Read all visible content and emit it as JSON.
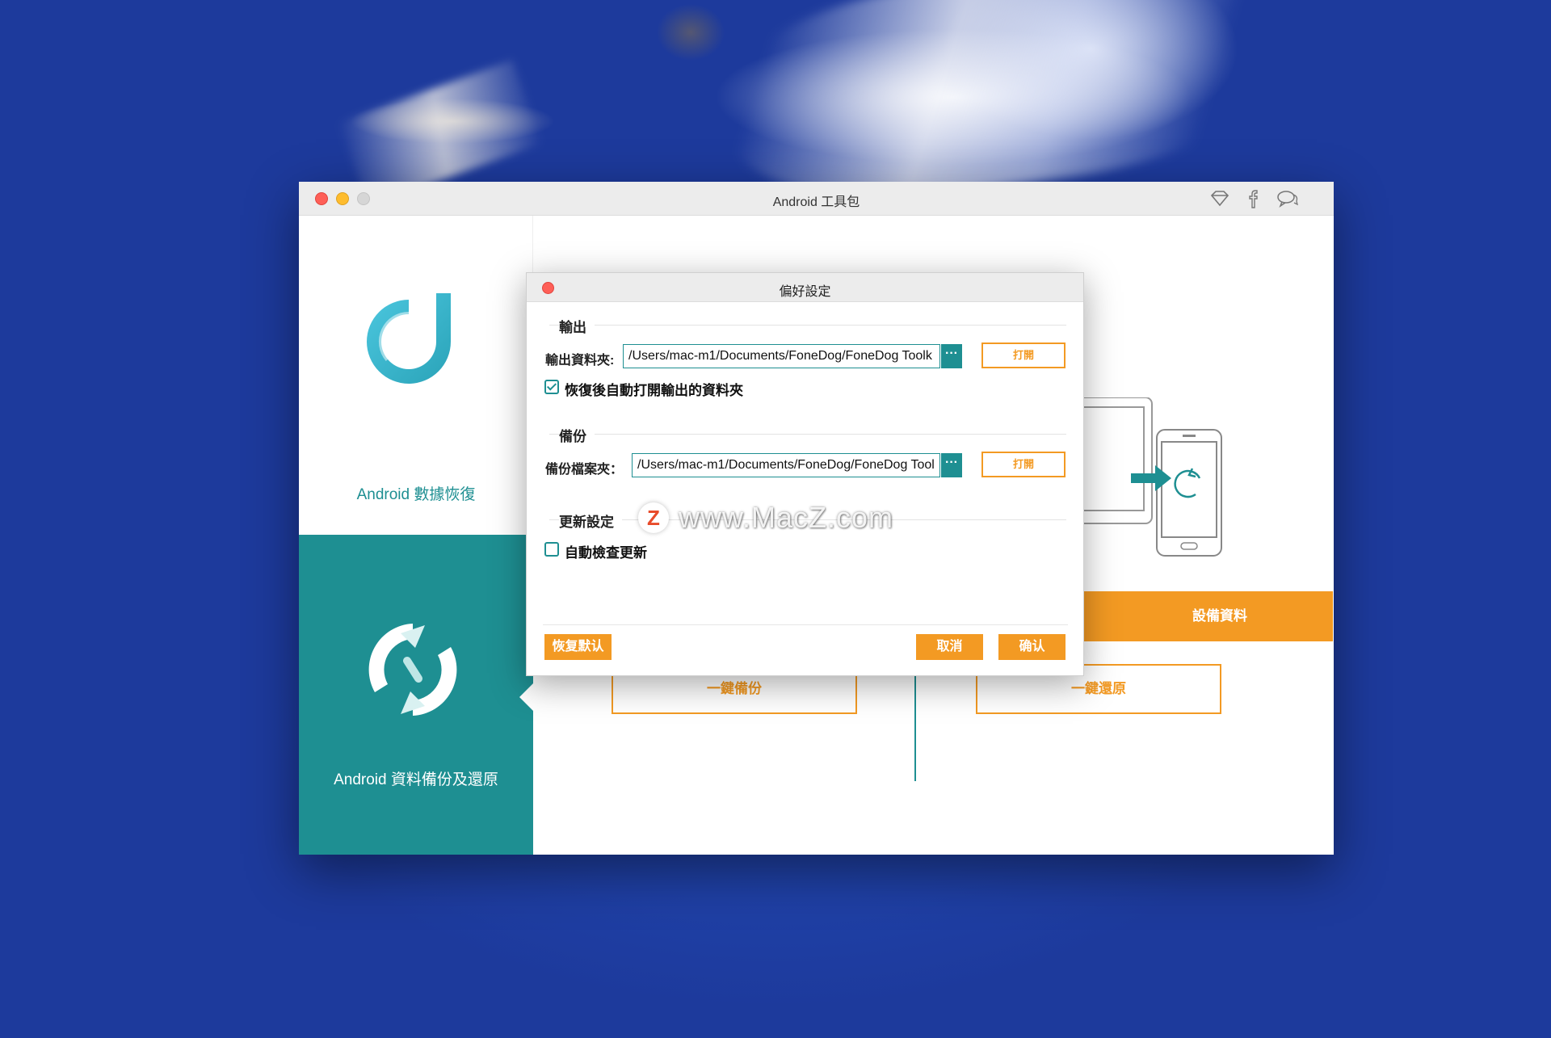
{
  "window": {
    "title": "Android 工具包",
    "toolbar_icons": [
      "diamond-icon",
      "facebook-icon",
      "chat-icon"
    ]
  },
  "sidebar": {
    "items": [
      {
        "label": "Android 數據恢復",
        "icon": "data-recovery-logo"
      },
      {
        "label": "Android 資料備份及還原",
        "icon": "sync-logo",
        "active": true
      }
    ]
  },
  "main": {
    "restore_device_button": "設備資料",
    "one_click_backup_button": "一鍵備份",
    "one_click_restore_button": "一鍵還原"
  },
  "dialog": {
    "title": "偏好設定",
    "output_section": "輸出",
    "output_folder_label": "輸出資料夾:",
    "output_folder_value": "/Users/mac-m1/Documents/FoneDog/FoneDog Toolk",
    "output_open_button": "打開",
    "auto_open_checkbox_label": "恢復後自動打開輸出的資料夾",
    "auto_open_checked": true,
    "backup_section": "備份",
    "backup_folder_label": "備份檔案夾：",
    "backup_folder_value": "/Users/mac-m1/Documents/FoneDog/FoneDog Tool",
    "backup_open_button": "打開",
    "update_section": "更新設定",
    "auto_update_checkbox_label": "自動檢查更新",
    "auto_update_checked": false,
    "browse_button": "···",
    "reset_button": "恢复默认",
    "cancel_button": "取消",
    "confirm_button": "确认"
  },
  "watermark": {
    "logo": "Z",
    "text": "www.MacZ.com"
  },
  "colors": {
    "teal": "#1e8f92",
    "orange": "#f39a23",
    "close_red": "#fe5f57",
    "minimize_yellow": "#febc2e"
  }
}
